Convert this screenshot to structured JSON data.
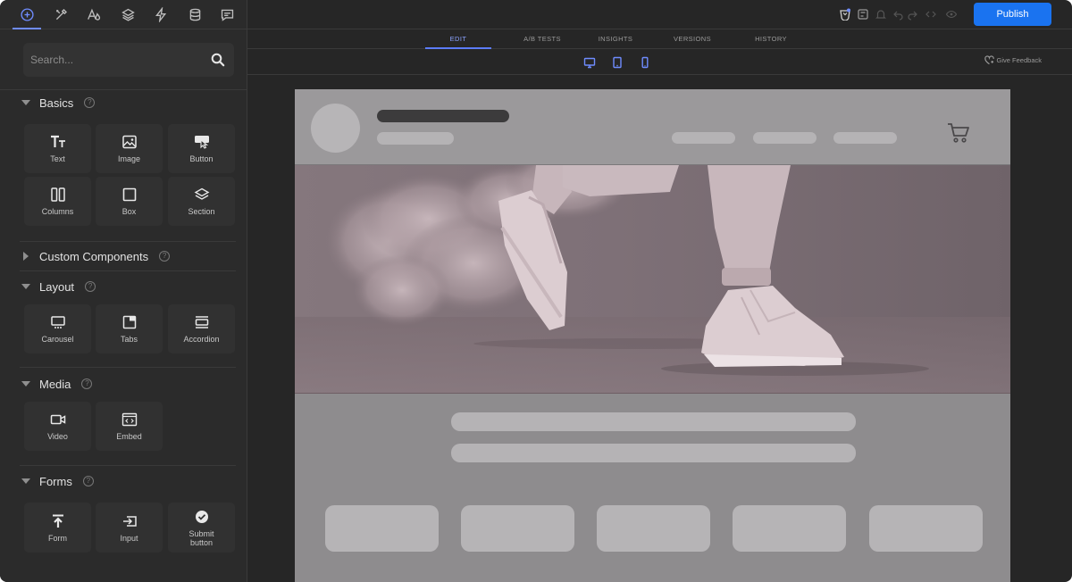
{
  "sidebar": {
    "tabs": [
      {
        "icon": "add-circle-icon",
        "active": true
      },
      {
        "icon": "design-tools-icon",
        "active": false
      },
      {
        "icon": "typography-icon",
        "active": false
      },
      {
        "icon": "layers-icon",
        "active": false
      },
      {
        "icon": "lightning-icon",
        "active": false
      },
      {
        "icon": "database-icon",
        "active": false
      },
      {
        "icon": "comment-icon",
        "active": false
      }
    ],
    "search": {
      "placeholder": "Search..."
    },
    "sections": {
      "basics": {
        "title": "Basics",
        "help": "?",
        "items": [
          {
            "label": "Text",
            "icon": "text-icon"
          },
          {
            "label": "Image",
            "icon": "image-icon"
          },
          {
            "label": "Button",
            "icon": "button-icon"
          },
          {
            "label": "Columns",
            "icon": "columns-icon"
          },
          {
            "label": "Box",
            "icon": "box-icon"
          },
          {
            "label": "Section",
            "icon": "section-icon"
          }
        ]
      },
      "custom": {
        "title": "Custom Components",
        "help": "?"
      },
      "layout": {
        "title": "Layout",
        "help": "?",
        "items": [
          {
            "label": "Carousel",
            "icon": "carousel-icon"
          },
          {
            "label": "Tabs",
            "icon": "tabs-icon"
          },
          {
            "label": "Accordion",
            "icon": "accordion-icon"
          }
        ]
      },
      "media": {
        "title": "Media",
        "help": "?",
        "items": [
          {
            "label": "Video",
            "icon": "video-icon"
          },
          {
            "label": "Embed",
            "icon": "embed-icon"
          }
        ]
      },
      "forms": {
        "title": "Forms",
        "help": "?",
        "items": [
          {
            "label": "Form",
            "icon": "form-icon"
          },
          {
            "label": "Input",
            "icon": "input-icon"
          },
          {
            "label": "Submit button",
            "icon": "submit-check-icon"
          }
        ]
      }
    }
  },
  "toolbar": {
    "publish_label": "Publish",
    "mode_tabs": [
      {
        "label": "EDIT",
        "active": true
      },
      {
        "label": "A/B TESTS",
        "active": false
      },
      {
        "label": "INSIGHTS",
        "active": false
      },
      {
        "label": "VERSIONS",
        "active": false
      },
      {
        "label": "HISTORY",
        "active": false
      }
    ],
    "devices": [
      "desktop-icon",
      "tablet-icon",
      "mobile-icon"
    ],
    "feedback_label": "Give Feedback"
  },
  "colors": {
    "accent": "#6f8cff",
    "publish": "#1a73f0",
    "panel": "#2b2b2b",
    "background": "#262626"
  }
}
